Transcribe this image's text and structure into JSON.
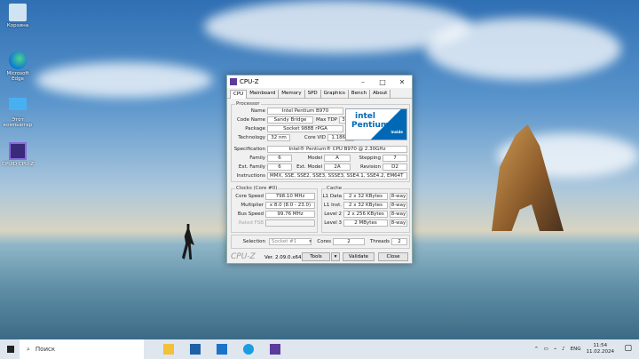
{
  "desktop": {
    "icons": [
      {
        "label": "Корзина",
        "icon": "recycle-bin-icon"
      },
      {
        "label": "Microsoft Edge",
        "icon": "edge-icon"
      },
      {
        "label": "Этот компьютер",
        "icon": "computer-icon"
      },
      {
        "label": "CPUID CPU-Z",
        "icon": "cpuz-icon"
      }
    ]
  },
  "window": {
    "title": "CPU-Z",
    "tabs": [
      "CPU",
      "Mainboard",
      "Memory",
      "SPD",
      "Graphics",
      "Bench",
      "About"
    ],
    "processor": {
      "group": "Processor",
      "name_label": "Name",
      "name": "Intel Pentium B970",
      "codename_label": "Code Name",
      "codename": "Sandy Bridge",
      "maxtdp_label": "Max TDP",
      "maxtdp": "35.0 W",
      "package_label": "Package",
      "package": "Socket 988B rPGA",
      "technology_label": "Technology",
      "technology": "32 nm",
      "corevid_label": "Core VID",
      "corevid": "1.186 V",
      "spec_label": "Specification",
      "spec": "Intel® Pentium® CPU B970 @ 2.30GHz",
      "family_label": "Family",
      "family": "6",
      "model_label": "Model",
      "model": "A",
      "stepping_label": "Stepping",
      "stepping": "7",
      "extfamily_label": "Ext. Family",
      "extfamily": "6",
      "extmodel_label": "Ext. Model",
      "extmodel": "2A",
      "revision_label": "Revision",
      "revision": "D2",
      "instr_label": "Instructions",
      "instr": "MMX, SSE, SSE2, SSE3, SSSE3, SSE4.1, SSE4.2, EM64T",
      "logo_brand": "intel",
      "logo_product": "Pentium",
      "logo_inside": "inside"
    },
    "clocks": {
      "group": "Clocks (Core #0)",
      "corespeed_label": "Core Speed",
      "corespeed": "798.10 MHz",
      "multiplier_label": "Multiplier",
      "multiplier": "x 8.0 (8.0 - 23.0)",
      "busspeed_label": "Bus Speed",
      "busspeed": "99.76 MHz",
      "ratedfsb_label": "Rated FSB",
      "ratedfsb": ""
    },
    "cache": {
      "group": "Cache",
      "rows": [
        {
          "label": "L1 Data",
          "size": "2 x 32 KBytes",
          "way": "8-way"
        },
        {
          "label": "L1 Inst.",
          "size": "2 x 32 KBytes",
          "way": "8-way"
        },
        {
          "label": "Level 2",
          "size": "2 x 256 KBytes",
          "way": "8-way"
        },
        {
          "label": "Level 3",
          "size": "2 MBytes",
          "way": "8-way"
        }
      ]
    },
    "selection_label": "Selection",
    "selection": "Socket #1",
    "cores_label": "Cores",
    "cores": "2",
    "threads_label": "Threads",
    "threads": "2",
    "brand": "CPU-Z",
    "version": "Ver. 2.09.0.x64",
    "tools": "Tools",
    "validate": "Validate",
    "close": "Close"
  },
  "taskbar": {
    "search_placeholder": "Поиск",
    "lang": "ENG",
    "time": "11:54",
    "date": "11.02.2024"
  }
}
